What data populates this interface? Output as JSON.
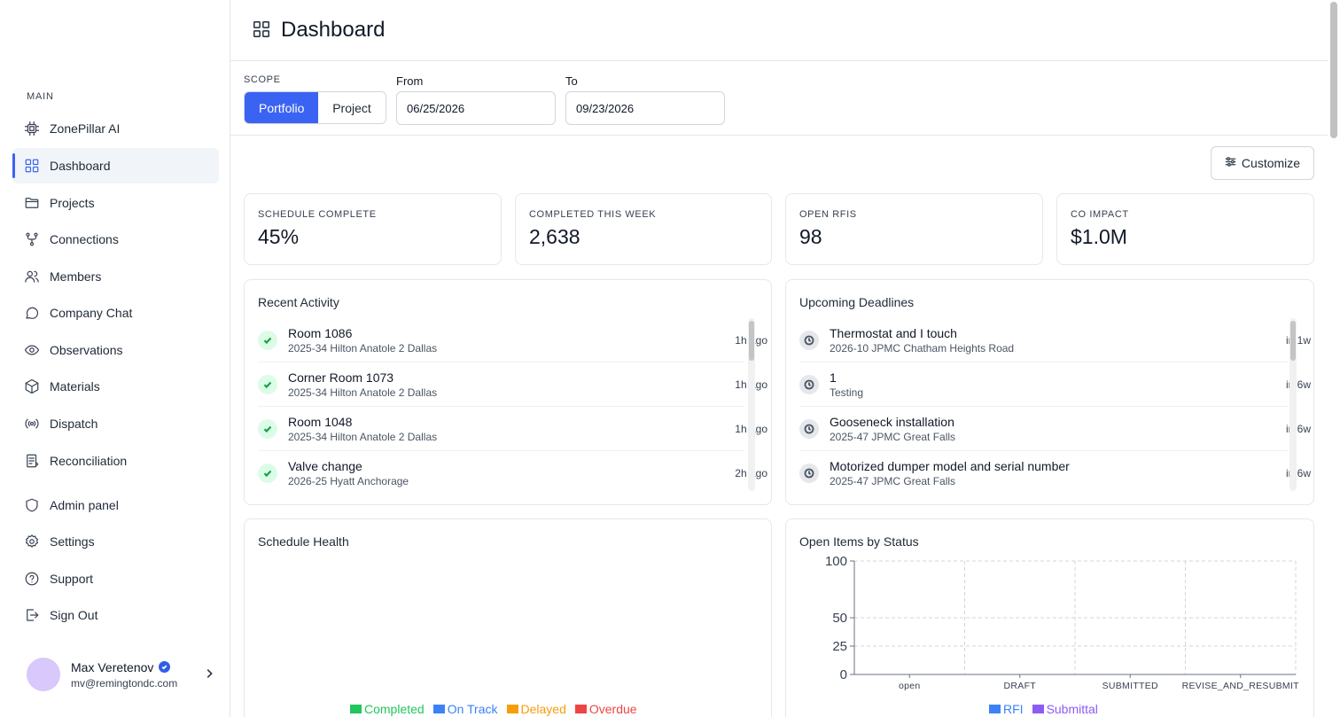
{
  "sidebar": {
    "section_label": "MAIN",
    "items": [
      {
        "label": "ZonePillar AI",
        "icon": "chip-icon"
      },
      {
        "label": "Dashboard",
        "icon": "grid-icon"
      },
      {
        "label": "Projects",
        "icon": "folder-icon"
      },
      {
        "label": "Connections",
        "icon": "fork-icon"
      },
      {
        "label": "Members",
        "icon": "users-icon"
      },
      {
        "label": "Company Chat",
        "icon": "chat-icon"
      },
      {
        "label": "Observations",
        "icon": "eye-icon"
      },
      {
        "label": "Materials",
        "icon": "box-icon"
      },
      {
        "label": "Dispatch",
        "icon": "broadcast-icon"
      },
      {
        "label": "Reconciliation",
        "icon": "clipboard-icon"
      }
    ],
    "footer_items": [
      {
        "label": "Admin panel",
        "icon": "shield-icon"
      },
      {
        "label": "Settings",
        "icon": "gear-icon"
      },
      {
        "label": "Support",
        "icon": "help-icon"
      },
      {
        "label": "Sign Out",
        "icon": "sign-out-icon"
      }
    ],
    "user": {
      "name": "Max Veretenov",
      "email": "mv@remingtondc.com"
    }
  },
  "header": {
    "title": "Dashboard"
  },
  "filters": {
    "scope_label": "SCOPE",
    "scope_options": [
      "Portfolio",
      "Project"
    ],
    "scope_selected": "Portfolio",
    "from_label": "From",
    "from_value": "06/25/2026",
    "to_label": "To",
    "to_value": "09/23/2026"
  },
  "customize_label": "Customize",
  "stats": [
    {
      "label": "SCHEDULE COMPLETE",
      "value": "45%"
    },
    {
      "label": "COMPLETED THIS WEEK",
      "value": "2,638"
    },
    {
      "label": "OPEN RFIS",
      "value": "98"
    },
    {
      "label": "CO IMPACT",
      "value": "$1.0M"
    }
  ],
  "recent_activity": {
    "title": "Recent Activity",
    "items": [
      {
        "title": "Room 1086",
        "sub": "2025-34 Hilton Anatole 2 Dallas",
        "time": "1h ago"
      },
      {
        "title": "Corner Room 1073",
        "sub": "2025-34 Hilton Anatole 2 Dallas",
        "time": "1h ago"
      },
      {
        "title": "Room 1048",
        "sub": "2025-34 Hilton Anatole 2 Dallas",
        "time": "1h ago"
      },
      {
        "title": "Valve change",
        "sub": "2026-25 Hyatt Anchorage",
        "time": "2h ago"
      }
    ]
  },
  "upcoming_deadlines": {
    "title": "Upcoming Deadlines",
    "items": [
      {
        "title": "Thermostat and I touch",
        "sub": "2026-10 JPMC Chatham Heights Road",
        "time": "in 1w"
      },
      {
        "title": "1",
        "sub": "Testing",
        "time": "in 6w"
      },
      {
        "title": "Gooseneck installation",
        "sub": "2025-47 JPMC Great Falls",
        "time": "in 6w"
      },
      {
        "title": "Motorized dumper model and serial number",
        "sub": "2025-47 JPMC Great Falls",
        "time": "in 6w"
      }
    ]
  },
  "schedule_health": {
    "title": "Schedule Health",
    "legend": [
      {
        "name": "Completed",
        "color": "#22c55e"
      },
      {
        "name": "On Track",
        "color": "#3b82f6"
      },
      {
        "name": "Delayed",
        "color": "#f59e0b"
      },
      {
        "name": "Overdue",
        "color": "#ef4444"
      }
    ]
  },
  "open_items": {
    "title": "Open Items by Status",
    "chart_data": {
      "type": "bar",
      "categories": [
        "open",
        "DRAFT",
        "SUBMITTED",
        "REVISE_AND_RESUBMIT"
      ],
      "yticks": [
        0,
        25,
        50,
        100
      ],
      "ylim": [
        0,
        100
      ],
      "grid": true,
      "legend_placement": "bottom",
      "series": [
        {
          "name": "RFI",
          "color": "#3b82f6",
          "values": [
            0,
            0,
            0,
            0
          ]
        },
        {
          "name": "Submittal",
          "color": "#8b5cf6",
          "values": [
            0,
            0,
            0,
            0
          ]
        }
      ]
    }
  }
}
